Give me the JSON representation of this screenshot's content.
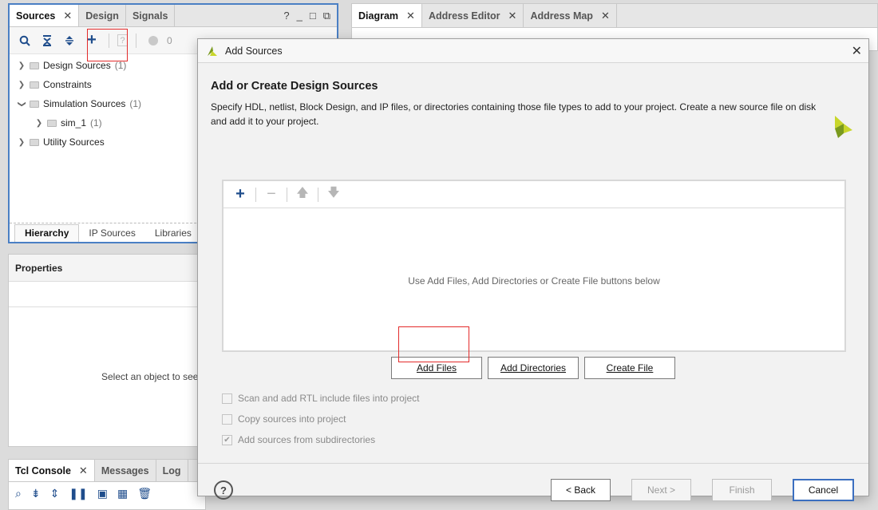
{
  "sources_panel": {
    "tabs": [
      {
        "label": "Sources"
      },
      {
        "label": "Design"
      },
      {
        "label": "Signals"
      }
    ],
    "header_icons": [
      "?",
      "_",
      "□",
      "⧉"
    ],
    "toolbar_icons": [
      "search-icon",
      "collapse-all-icon",
      "expand-all-icon",
      "add-icon",
      "help-icon",
      "status-dot-icon"
    ],
    "status_count": "0",
    "tree": [
      {
        "label": "Design Sources",
        "count": "(1)"
      },
      {
        "label": "Constraints",
        "count": ""
      },
      {
        "label": "Simulation Sources",
        "count": "(1)"
      },
      {
        "label": "sim_1",
        "count": "(1)"
      },
      {
        "label": "Utility Sources",
        "count": ""
      }
    ],
    "bottom_tabs": [
      "Hierarchy",
      "IP Sources",
      "Libraries"
    ]
  },
  "properties": {
    "title": "Properties",
    "placeholder": "Select an object to see"
  },
  "tcl": {
    "tabs": [
      "Tcl Console",
      "Messages",
      "Log"
    ]
  },
  "diagram_tabs": [
    "Diagram",
    "Address Editor",
    "Address Map"
  ],
  "dialog": {
    "title": "Add Sources",
    "heading": "Add or Create Design Sources",
    "description": "Specify HDL, netlist, Block Design, and IP files, or directories containing those file types to add to your project. Create a new source file on disk and add it to your project.",
    "empty_message": "Use Add Files, Add Directories or Create File buttons below",
    "buttons": {
      "add_files": "Add Files",
      "add_directories": "Add Directories",
      "create_file": "Create File",
      "back": "< Back",
      "next": "Next >",
      "finish": "Finish",
      "cancel": "Cancel"
    },
    "options": [
      {
        "label": "Scan and add RTL include files into project",
        "checked": false
      },
      {
        "label": "Copy sources into project",
        "checked": false
      },
      {
        "label": "Add sources from subdirectories",
        "checked": true
      }
    ],
    "help": "?"
  }
}
